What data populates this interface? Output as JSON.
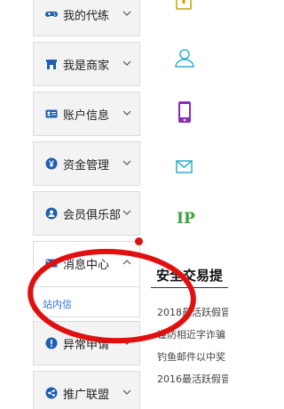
{
  "sidebar": {
    "items": [
      {
        "label": "我的代练",
        "icon": "gamepad-icon",
        "icon_color": "#1f5fb0"
      },
      {
        "label": "我是商家",
        "icon": "store-icon",
        "icon_color": "#1f5fb0"
      },
      {
        "label": "账户信息",
        "icon": "id-card-icon",
        "icon_color": "#1f5fb0"
      },
      {
        "label": "资金管理",
        "icon": "yen-icon",
        "icon_color": "#1f5fb0"
      },
      {
        "label": "会员俱乐部",
        "icon": "member-icon",
        "icon_color": "#1f5fb0"
      },
      {
        "label": "消息中心",
        "icon": "mail-icon",
        "icon_color": "#1f5fb0",
        "expanded": true,
        "sub_items": [
          {
            "label": "站内信"
          }
        ]
      },
      {
        "label": "异常申请",
        "icon": "alert-icon",
        "icon_color": "#1f5fb0"
      },
      {
        "label": "推广联盟",
        "icon": "share-icon",
        "icon_color": "#1f5fb0"
      }
    ]
  },
  "right_icons": [
    {
      "icon": "shield-lock-icon",
      "color": "#c9a400"
    },
    {
      "icon": "user-icon",
      "color": "#2fb0c9"
    },
    {
      "icon": "mobile-phone-icon",
      "color": "#8a2bb8"
    },
    {
      "icon": "email-icon",
      "color": "#2fb0c9"
    },
    {
      "icon": "ip-icon",
      "text": "IP",
      "color": "#3aa23a"
    }
  ],
  "news": {
    "title": "安全交易提",
    "items": [
      "2018最活跃假冒",
      "谨防相近字诈骗",
      "钓鱼邮件以中奖",
      "2016最活跃假冒"
    ]
  },
  "colors": {
    "accent_blue": "#1f5fb0",
    "link_blue": "#2a6fd6",
    "annotation_red": "#e01010"
  }
}
